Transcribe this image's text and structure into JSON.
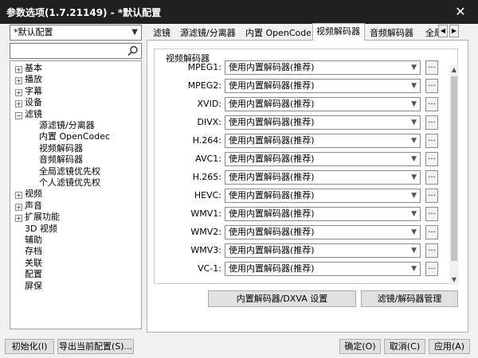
{
  "window": {
    "title": "参数选项(1.7.21149) - *默认配置",
    "close_glyph": "✕"
  },
  "profile": {
    "selected": "*默认配置"
  },
  "search": {
    "placeholder": ""
  },
  "tree": [
    {
      "label": "基本",
      "level": 0,
      "expander": "+"
    },
    {
      "label": "播放",
      "level": 0,
      "expander": "+"
    },
    {
      "label": "字幕",
      "level": 0,
      "expander": "+"
    },
    {
      "label": "设备",
      "level": 0,
      "expander": "+"
    },
    {
      "label": "滤镜",
      "level": 0,
      "expander": "−"
    },
    {
      "label": "源滤镜/分离器",
      "level": 1,
      "expander": ""
    },
    {
      "label": "内置 OpenCodec",
      "level": 1,
      "expander": ""
    },
    {
      "label": "视频解码器",
      "level": 1,
      "expander": ""
    },
    {
      "label": "音频解码器",
      "level": 1,
      "expander": ""
    },
    {
      "label": "全局滤镜优先权",
      "level": 1,
      "expander": ""
    },
    {
      "label": "个人滤镜优先权",
      "level": 1,
      "expander": ""
    },
    {
      "label": "视频",
      "level": 0,
      "expander": "+"
    },
    {
      "label": "声音",
      "level": 0,
      "expander": "+"
    },
    {
      "label": "扩展功能",
      "level": 0,
      "expander": "+"
    },
    {
      "label": "3D 视频",
      "level": 0,
      "expander": ""
    },
    {
      "label": "辅助",
      "level": 0,
      "expander": ""
    },
    {
      "label": "存档",
      "level": 0,
      "expander": ""
    },
    {
      "label": "关联",
      "level": 0,
      "expander": ""
    },
    {
      "label": "配置",
      "level": 0,
      "expander": ""
    },
    {
      "label": "屏保",
      "level": 0,
      "expander": ""
    }
  ],
  "tabs": [
    {
      "label": "滤镜",
      "active": false
    },
    {
      "label": "源滤镜/分离器",
      "active": false
    },
    {
      "label": "内置 OpenCodec",
      "active": false
    },
    {
      "label": "视频解码器",
      "active": true
    },
    {
      "label": "音频解码器",
      "active": false
    },
    {
      "label": "全局滤",
      "active": false
    }
  ],
  "tab_nav": {
    "prev": "◀",
    "next": "▶"
  },
  "group": {
    "title": "视频解码器"
  },
  "decoders": [
    {
      "label": "MPEG1:",
      "value": "使用内置解码器(推荐)"
    },
    {
      "label": "MPEG2:",
      "value": "使用内置解码器(推荐)"
    },
    {
      "label": "XVID:",
      "value": "使用内置解码器(推荐)"
    },
    {
      "label": "DIVX:",
      "value": "使用内置解码器(推荐)"
    },
    {
      "label": "H.264:",
      "value": "使用内置解码器(推荐)"
    },
    {
      "label": "AVC1:",
      "value": "使用内置解码器(推荐)"
    },
    {
      "label": "H.265:",
      "value": "使用内置解码器(推荐)"
    },
    {
      "label": "HEVC:",
      "value": "使用内置解码器(推荐)"
    },
    {
      "label": "WMV1:",
      "value": "使用内置解码器(推荐)"
    },
    {
      "label": "WMV2:",
      "value": "使用内置解码器(推荐)"
    },
    {
      "label": "WMV3:",
      "value": "使用内置解码器(推荐)"
    },
    {
      "label": "VC-1:",
      "value": "使用内置解码器(推荐)"
    }
  ],
  "more_label": "...",
  "panel_buttons": {
    "dxva": "内置解码器/DXVA 设置",
    "manage": "滤镜/解码器管理"
  },
  "footer": {
    "init": "初始化(I)",
    "export": "导出当前配置(S)...",
    "ok": "确定(O)",
    "cancel": "取消(C)",
    "apply": "应用(A)"
  }
}
